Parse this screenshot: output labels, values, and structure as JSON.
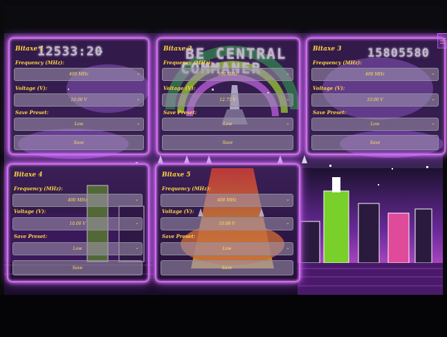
{
  "hud": {
    "score_left": "12533:20",
    "score_right": "15805580",
    "title_line1": "BE CENTRAL",
    "title_line2": "COMMANER"
  },
  "menu_icon": "menu-icon",
  "panels": [
    {
      "title": "Bitaxe 1",
      "frequency_label": "Frequency (MHz):",
      "frequency": "400 MHz",
      "voltage_label": "Voltage (V):",
      "voltage": "10.00 V",
      "preset_label": "Save Preset:",
      "preset": "Low",
      "save": "Save"
    },
    {
      "title": "Bitaxe 2",
      "frequency_label": "Frequency (MHz):",
      "frequency": "500 MHz",
      "voltage_label": "Voltage (V):",
      "voltage": "12.75 V",
      "preset_label": "Save Preset:",
      "preset": "Low",
      "save": "Save"
    },
    {
      "title": "Bitaxe 3",
      "frequency_label": "Frequency (MHz):",
      "frequency": "400 MHz",
      "voltage_label": "Voltage (V):",
      "voltage": "10.00 V",
      "preset_label": "Save Preset:",
      "preset": "Low",
      "save": "Save"
    },
    {
      "title": "Bitaxe 4",
      "frequency_label": "Frequency (MHz):",
      "frequency": "400 MHz",
      "voltage_label": "Voltage (V):",
      "voltage": "10.00 V",
      "preset_label": "Save Preset:",
      "preset": "Low",
      "save": "Save"
    },
    {
      "title": "Bitaxe 5",
      "frequency_label": "Frequency (MHz):",
      "frequency": "400 MHz",
      "voltage_label": "Voltage (V):",
      "voltage": "10.00 V",
      "preset_label": "Save Preset:",
      "preset": "Low",
      "save": "Save"
    }
  ],
  "colors": {
    "accent": "#ffd23f",
    "glow": "#d06cf0",
    "field_bg": "#a096af"
  }
}
